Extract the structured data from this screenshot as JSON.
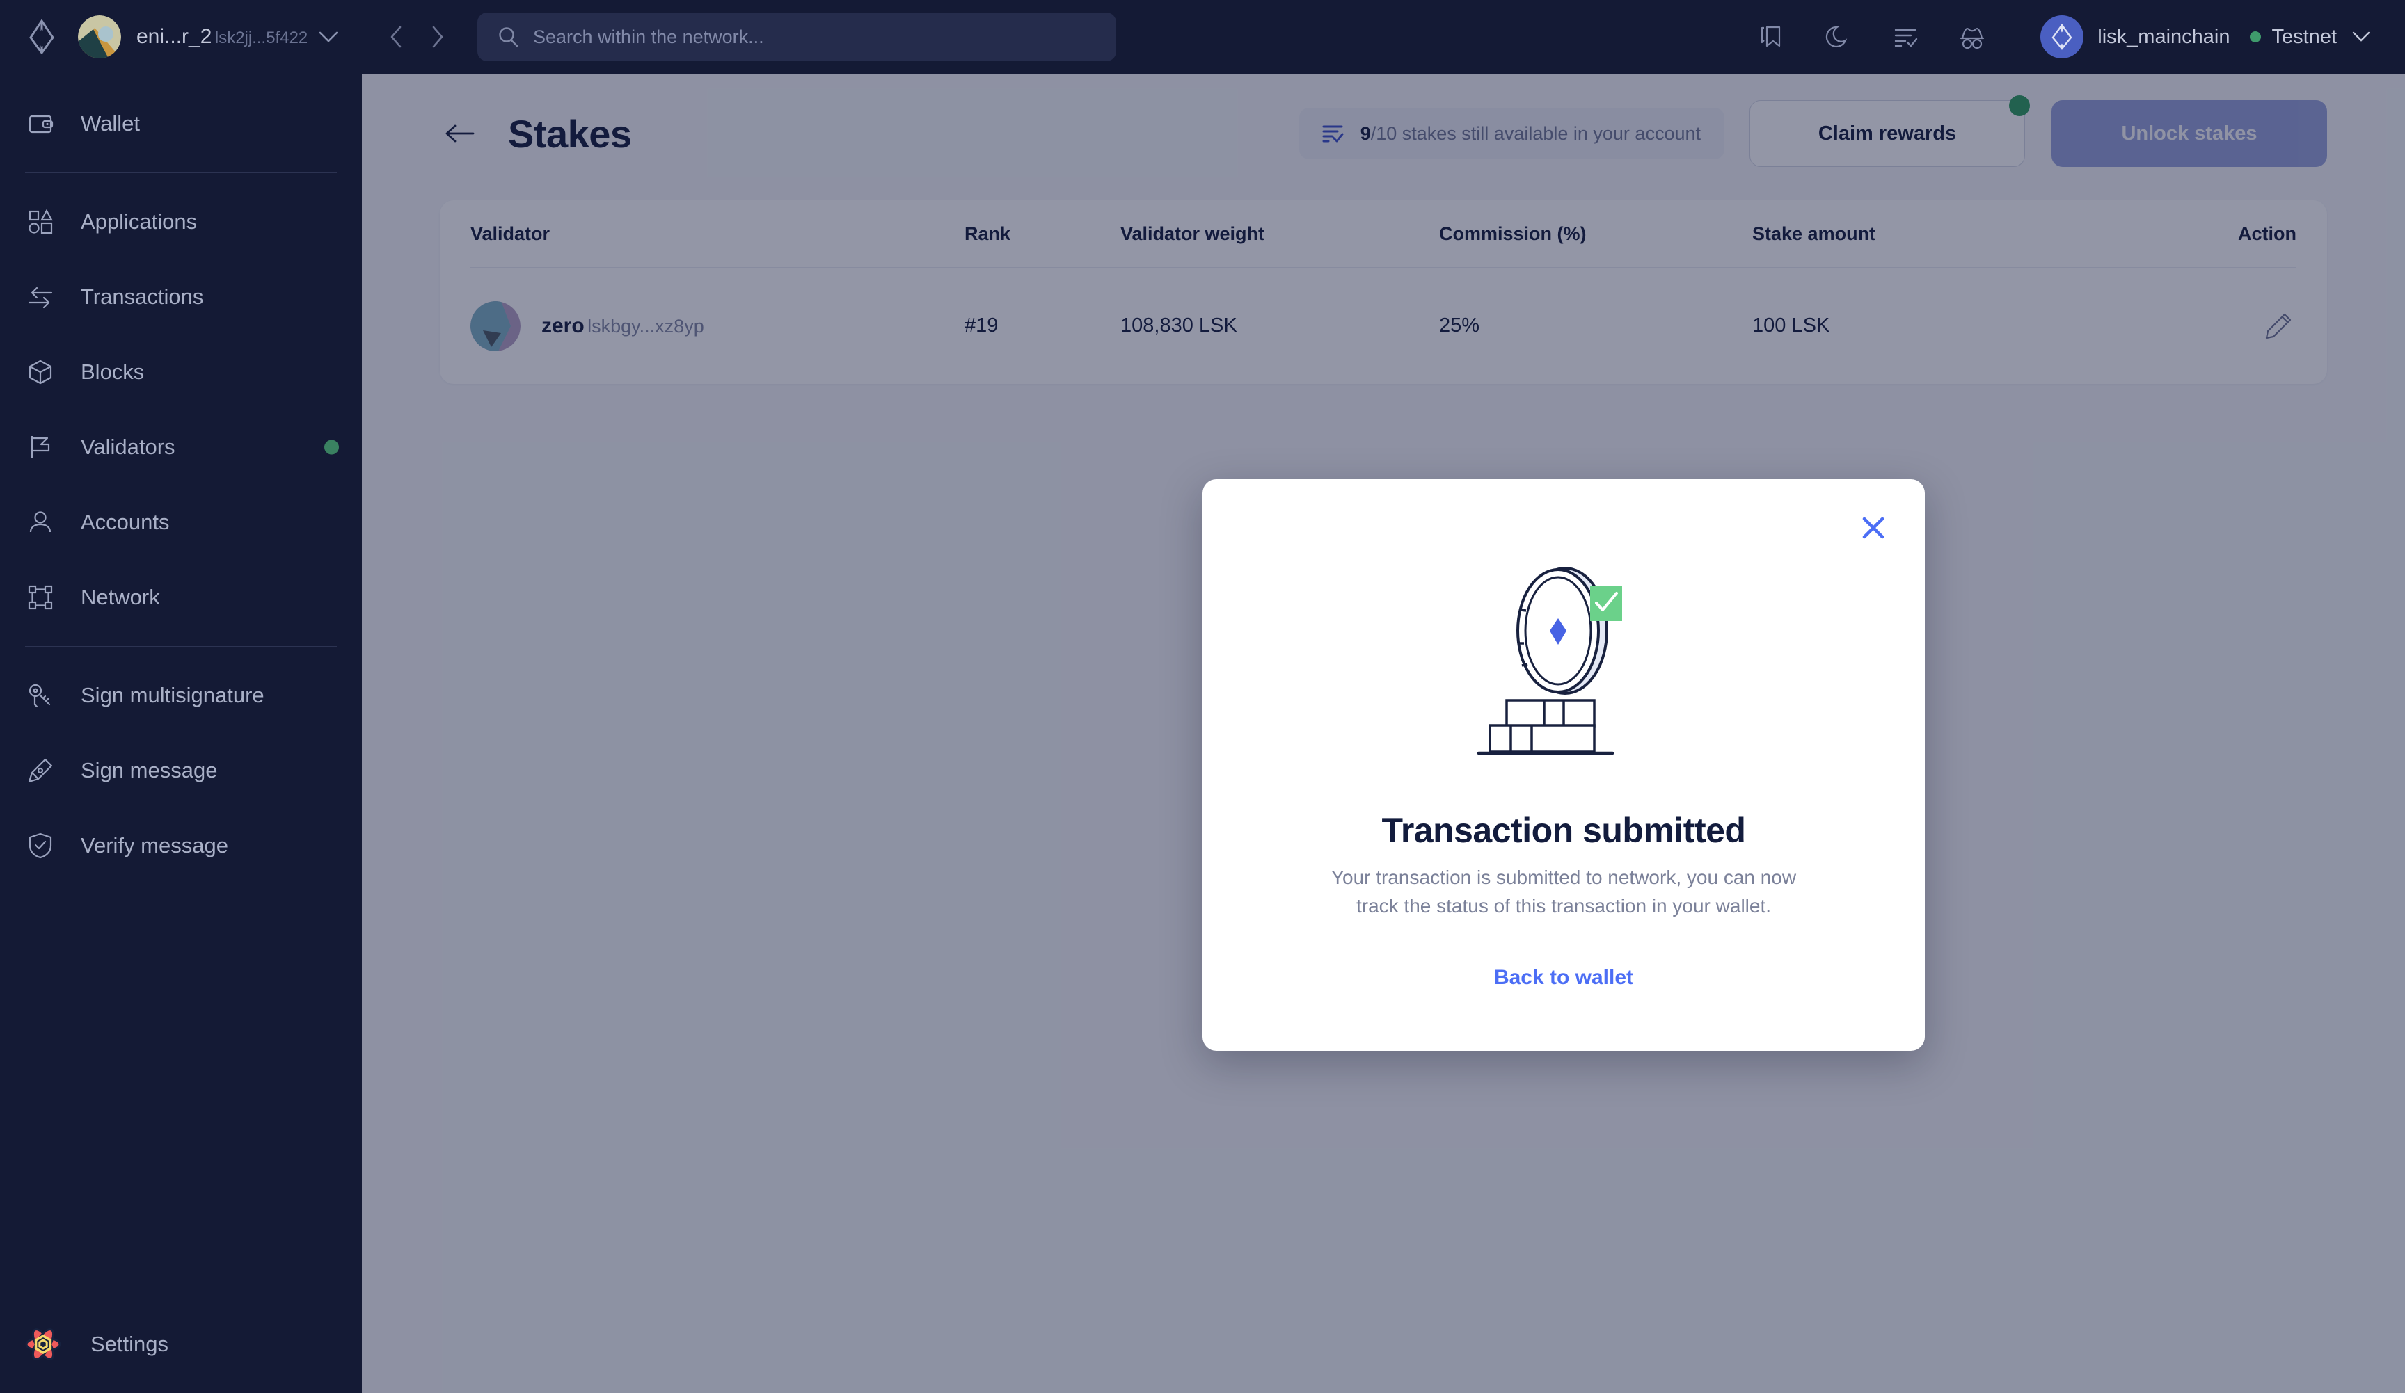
{
  "sidebar": {
    "account": {
      "name": "eni...r_2",
      "address": "lsk2jj...5f422",
      "logo_icon": "lisk-logo-icon",
      "avatar_icon": "account-avatar",
      "chevron_icon": "chevron-down-icon"
    },
    "groups": [
      {
        "items": [
          {
            "label": "Wallet",
            "icon": "wallet-icon",
            "dot": false
          }
        ]
      },
      {
        "items": [
          {
            "label": "Applications",
            "icon": "applications-icon",
            "dot": false
          },
          {
            "label": "Transactions",
            "icon": "transactions-icon",
            "dot": false
          },
          {
            "label": "Blocks",
            "icon": "blocks-icon",
            "dot": false
          },
          {
            "label": "Validators",
            "icon": "validators-flag-icon",
            "dot": true
          },
          {
            "label": "Accounts",
            "icon": "accounts-person-icon",
            "dot": false
          },
          {
            "label": "Network",
            "icon": "network-nodes-icon",
            "dot": false
          }
        ]
      },
      {
        "items": [
          {
            "label": "Sign multisignature",
            "icon": "keys-icon",
            "dot": false
          },
          {
            "label": "Sign message",
            "icon": "pen-nib-icon",
            "dot": false
          },
          {
            "label": "Verify message",
            "icon": "shield-check-icon",
            "dot": false
          }
        ]
      }
    ],
    "footer": {
      "label": "Settings",
      "icon": "settings-atom-icon"
    },
    "status_dot_color": "#3a8161"
  },
  "topbar": {
    "nav_back_icon": "chevron-left-icon",
    "nav_forward_icon": "chevron-right-icon",
    "search": {
      "placeholder": "Search within the network...",
      "value": "",
      "icon": "search-icon"
    },
    "icons": [
      {
        "name": "bookmarks-icon"
      },
      {
        "name": "dark-mode-moon-icon"
      },
      {
        "name": "transactions-filter-icon"
      },
      {
        "name": "incognito-icon"
      }
    ],
    "chain": {
      "name": "lisk_mainchain",
      "network": "Testnet",
      "network_dot_color": "#3f9a6c",
      "logo_icon": "lisk-coin-icon",
      "chevron_icon": "chevron-down-icon"
    }
  },
  "page": {
    "back_icon": "arrow-left-icon",
    "title": "Stakes",
    "stakes_badge": {
      "icon": "stakes-list-icon",
      "highlight": "9",
      "rest": "/10 stakes still available in your account"
    },
    "claim_button": {
      "label": "Claim rewards",
      "has_notification_dot": true
    },
    "unlock_button": {
      "label": "Unlock stakes",
      "disabled": true
    }
  },
  "table": {
    "columns": [
      "Validator",
      "Rank",
      "Validator weight",
      "Commission (%)",
      "Stake amount",
      "Action"
    ],
    "rows": [
      {
        "validator_name": "zero",
        "validator_address": "lskbgy...xz8yp",
        "rank": "#19",
        "weight": "108,830 LSK",
        "commission": "25%",
        "stake_amount": "100 LSK",
        "action_icon": "edit-pencil-icon"
      }
    ]
  },
  "modal": {
    "close_icon": "close-x-icon",
    "illustration": "coin-on-bricks-success-icon",
    "title": "Transaction submitted",
    "description": "Your transaction is submitted to network, you can now track the status of this transaction in your wallet.",
    "link_label": "Back to wallet",
    "accent_color": "#4c6ef5",
    "success_color": "#6bd18a"
  }
}
